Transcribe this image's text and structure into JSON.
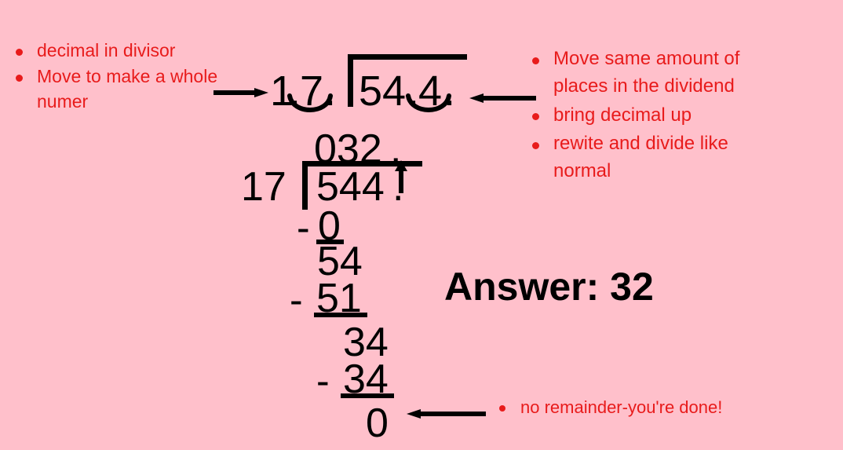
{
  "slide": {
    "background_color": "#FFC0CB",
    "text_color_red": "#E81B1B",
    "text_color_black": "#000000"
  },
  "left_bullets": {
    "items": [
      "decimal in divisor",
      "Move to make a whole numer"
    ]
  },
  "right_bullets": {
    "items": [
      "Move same amount of places in the dividend",
      "bring decimal up",
      "rewite and divide like normal"
    ]
  },
  "bottom_bullet": {
    "items": [
      "no remainder-you're done!"
    ]
  },
  "top_problem": {
    "divisor": "1",
    "divisor_decimal": ".",
    "divisor_digit2": "7",
    "divisor_trailing_dot": ".",
    "dividend_left": "54",
    "dividend_decimal": ".",
    "dividend_digit": "4",
    "dividend_trailing_dot": "."
  },
  "long_division": {
    "quotient": "032",
    "quotient_decimal": ".",
    "divisor": "17",
    "dividend": "544",
    "dividend_decimal": ".",
    "steps": [
      {
        "minus": "-",
        "value": "0"
      },
      {
        "minus": "",
        "value": "54"
      },
      {
        "minus": "-",
        "value": "51"
      },
      {
        "minus": "",
        "value": "34"
      },
      {
        "minus": "-",
        "value": "34"
      },
      {
        "minus": "",
        "value": "0"
      }
    ]
  },
  "answer": {
    "label": "Answer: 32"
  }
}
